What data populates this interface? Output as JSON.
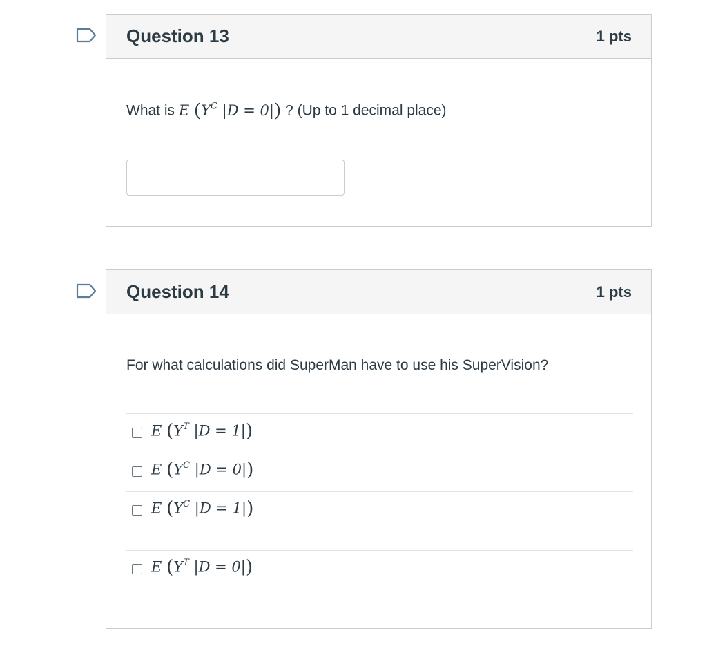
{
  "questions": [
    {
      "title": "Question 13",
      "points": "1 pts",
      "prompt_prefix": "What is",
      "prompt_math": {
        "func": "E",
        "var": "Y",
        "sup": "C",
        "cond": "D = 0"
      },
      "prompt_suffix": "? (Up to 1 decimal place)",
      "answer_value": "",
      "flag_icon": "bookmark-flag-icon"
    },
    {
      "title": "Question 14",
      "points": "1 pts",
      "prompt": "For what calculations did SuperMan have to use his SuperVision?",
      "flag_icon": "bookmark-flag-icon",
      "options": [
        {
          "func": "E",
          "var": "Y",
          "sup": "T",
          "cond": "D = 1",
          "checked": false
        },
        {
          "func": "E",
          "var": "Y",
          "sup": "C",
          "cond": "D = 0",
          "checked": false
        },
        {
          "func": "E",
          "var": "Y",
          "sup": "C",
          "cond": "D = 1",
          "checked": false
        },
        {
          "func": "E",
          "var": "Y",
          "sup": "T",
          "cond": "D = 0",
          "checked": false
        }
      ]
    }
  ],
  "colors": {
    "text": "#2d3b45",
    "border": "#c7cdd1",
    "header_bg": "#f5f5f5",
    "flag": "#5a7d99"
  }
}
